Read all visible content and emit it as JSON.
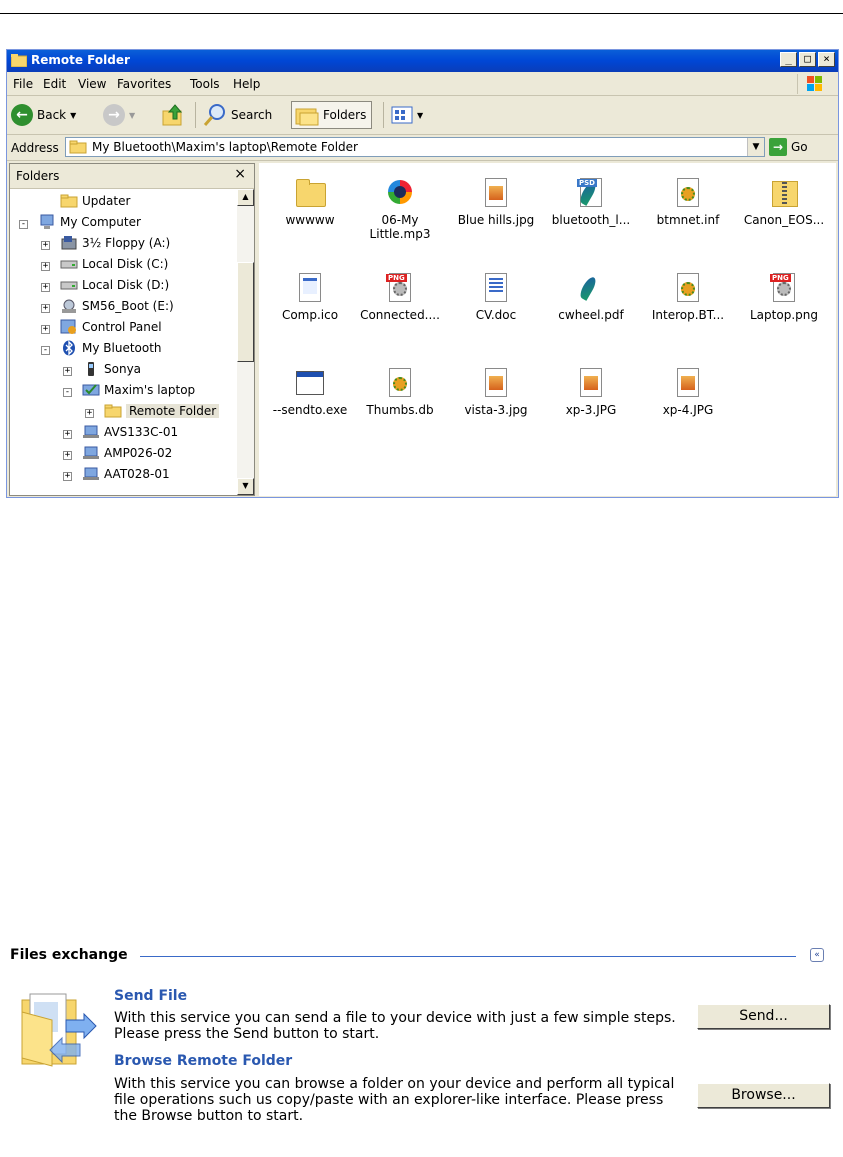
{
  "window": {
    "title": "Remote Folder",
    "caption_min": "_",
    "caption_max": "□",
    "caption_close": "×"
  },
  "menu": [
    "File",
    "Edit",
    "View",
    "Favorites",
    "Tools",
    "Help"
  ],
  "toolbar": {
    "back": "Back",
    "search": "Search",
    "folders": "Folders"
  },
  "address": {
    "label": "Address",
    "value": "My Bluetooth\\Maxim's laptop\\Remote Folder",
    "go": "Go"
  },
  "folders_pane": {
    "title": "Folders",
    "close": "×",
    "tree": [
      "Updater",
      "My Computer",
      "3½ Floppy (A:)",
      "Local Disk (C:)",
      "Local Disk (D:)",
      "SM56_Boot (E:)",
      "Control Panel",
      "My Bluetooth",
      "Sonya",
      "Maxim's laptop",
      "Remote Folder",
      "AVS133C-01",
      "AMP026-02",
      "AAT028-01"
    ]
  },
  "files": [
    "wwwww",
    "06-My Little.mp3",
    "Blue hills.jpg",
    "bluetooth_l...",
    "btmnet.inf",
    "Canon_EOS...",
    "Comp.ico",
    "Connected....",
    "CV.doc",
    "cwheel.pdf",
    "Interop.BT...",
    "Laptop.png",
    "--sendto.exe",
    "Thumbs.db",
    "vista-3.jpg",
    "xp-3.JPG",
    "xp-4.JPG"
  ],
  "files_exchange": {
    "title": "Files exchange",
    "collapse": "«",
    "send": {
      "heading": "Send File",
      "text": "With this service you can send a file to your device with just a few simple steps. Please press the Send button to start.",
      "button": "Send..."
    },
    "browse": {
      "heading": "Browse Remote Folder",
      "text": "With this service you can browse a folder on your device and perform all typical file operations such us copy/paste with an explorer-like interface. Please press the Browse button to start.",
      "button": "Browse..."
    }
  }
}
